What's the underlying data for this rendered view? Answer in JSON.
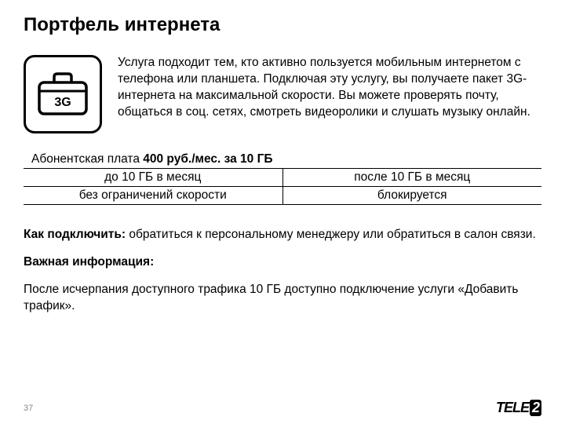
{
  "title": "Портфель интернета",
  "icon_label": "3G",
  "description": "Услуга подходит тем, кто активно пользуется мобильным интернетом с телефона или планшета. Подключая эту услугу, вы получаете пакет 3G-интернета на максимальной скорости. Вы можете проверять почту, общаться в соц. сетях, смотреть видеоролики и слушать музыку онлайн.",
  "fee": {
    "prefix": "Абонентская плата ",
    "bold": "400 руб./мес. за 10 ГБ"
  },
  "table": {
    "headers": [
      "до 10 ГБ в месяц",
      "после 10 ГБ в месяц"
    ],
    "row": [
      "без ограничений скорости",
      "блокируется"
    ]
  },
  "howto": {
    "label": "Как подключить: ",
    "text": "обратиться к персональному менеджеру или обратиться в салон связи."
  },
  "important": {
    "label": "Важная информация:",
    "text": "После исчерпания доступного трафика 10 ГБ доступно подключение услуги «Добавить трафик»."
  },
  "page_number": "37",
  "logo": {
    "part1": "TELE",
    "part2": "2"
  }
}
